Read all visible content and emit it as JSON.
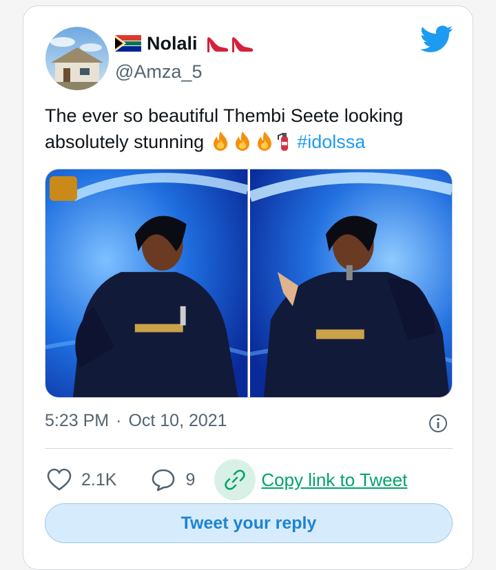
{
  "tweet": {
    "display_name": "Nolali",
    "handle": "@Amza_5",
    "text": "The ever so beautiful Thembi Seete looking absolutely stunning",
    "hashtag": "#idolssa",
    "timestamp_time": "5:23 PM",
    "timestamp_separator": "·",
    "timestamp_date": "Oct 10, 2021",
    "like_count": "2.1K",
    "reply_count": "9",
    "copy_link_label": "Copy link to Tweet",
    "reply_button_label": "Tweet your reply"
  },
  "icons": {
    "flag": "south-africa-flag-icon",
    "name_emoji": "high-heel-icon",
    "text_emoji": [
      "fire-icon",
      "fire-icon",
      "fire-icon",
      "fire-extinguisher-icon"
    ],
    "brand": "twitter-bird-icon",
    "info": "info-icon",
    "like": "heart-icon",
    "reply": "reply-bubble-icon",
    "copy": "link-icon"
  },
  "colors": {
    "accent": "#1d9bf0",
    "link_green": "#00a368",
    "text_primary": "#0f1419",
    "text_secondary": "#536471",
    "border": "#cfd9de"
  }
}
